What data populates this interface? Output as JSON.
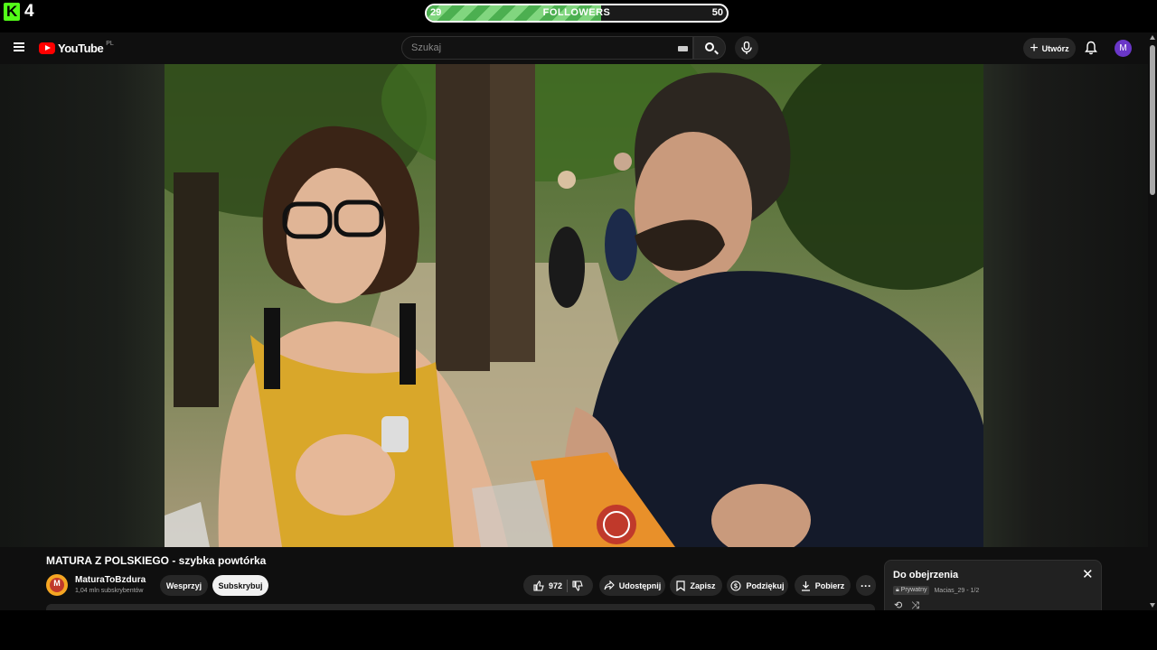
{
  "overlay": {
    "kick_count": "4",
    "followers": {
      "label": "FOLLOWERS",
      "current": "29",
      "goal": "50",
      "progress": 0.58
    }
  },
  "header": {
    "logo_text": "YouTube",
    "country": "PL",
    "search_placeholder": "Szukaj",
    "create_label": "Utwórz",
    "avatar_letter": "M"
  },
  "video": {
    "title": "MATURA Z POLSKIEGO - szybka powtórka"
  },
  "channel": {
    "avatar_letter": "M",
    "name": "MaturaToBzdura",
    "subscribers": "1,04 mln subskrybentów",
    "join_label": "Wesprzyj",
    "subscribe_label": "Subskrybuj"
  },
  "actions": {
    "likes": "972",
    "share": "Udostępnij",
    "save": "Zapisz",
    "thanks": "Podziękuj",
    "download": "Pobierz",
    "more": "···"
  },
  "playlist": {
    "title": "Do obejrzenia",
    "privacy": "Prywatny",
    "owner_position": "Macias_29 - 1/2"
  },
  "colors": {
    "youtube_red": "#ff0000",
    "kick_green": "#53fc18",
    "avatar_purple": "#6a37c8"
  }
}
